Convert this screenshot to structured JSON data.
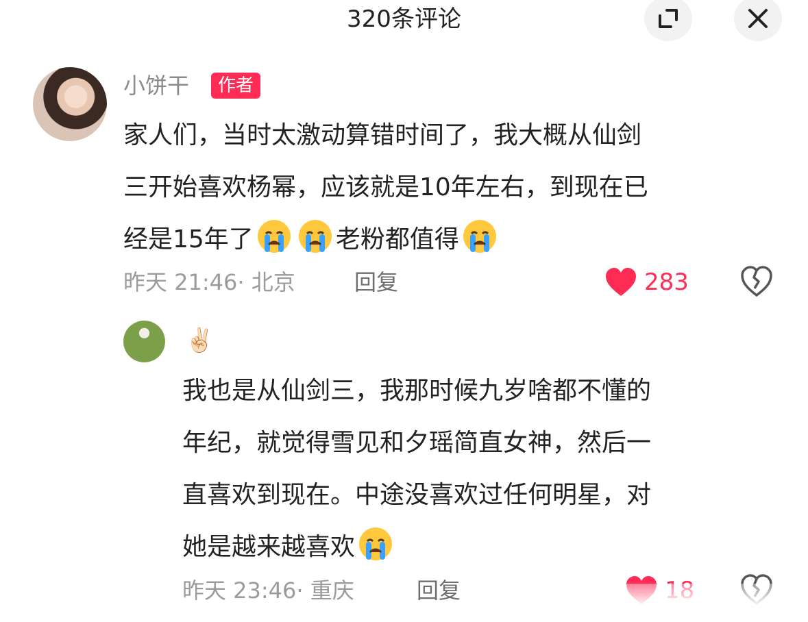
{
  "header": {
    "title": "320条评论"
  },
  "comments": [
    {
      "username": "小饼干",
      "badge": "作者",
      "lines": [
        "家人们，当时太激动算错时间了，我大概从仙剑",
        "三开始喜欢杨幂，应该就是10年左右，到现在已",
        "经是15年了"
      ],
      "line3_tail": "老粉都值得",
      "time": "昨天 21:46· 北京",
      "reply_label": "回复",
      "likes": "283",
      "liked": true
    },
    {
      "username": "",
      "lines": [
        "我也是从仙剑三，我那时候九岁啥都不懂的",
        "年纪，就觉得雪见和夕瑶简直女神，然后一",
        "直喜欢到现在。中途没喜欢过任何明星，对",
        "她是越来越喜欢"
      ],
      "time": "昨天 23:46· 重庆",
      "reply_label": "回复",
      "likes": "18",
      "liked": true
    }
  ],
  "colors": {
    "accent": "#fe2c55",
    "text": "#222222",
    "muted": "#9b9b9b"
  },
  "icons": {
    "expand": "expand-icon",
    "close": "close-icon",
    "heart": "heart-icon",
    "dislike": "broken-heart-icon",
    "emoji": "loudly-crying-face-icon"
  }
}
